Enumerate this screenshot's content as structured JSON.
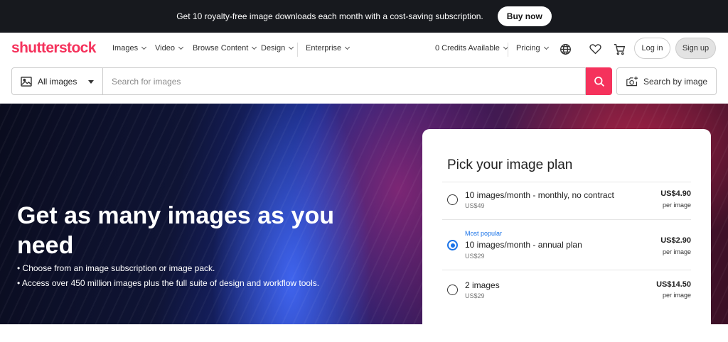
{
  "promo": {
    "text": "Get 10 royalty-free image downloads each month with a cost-saving subscription.",
    "button": "Buy now"
  },
  "header": {
    "logo": "shutterstock",
    "nav": [
      "Images",
      "Video",
      "Browse Content",
      "Design",
      "Enterprise"
    ],
    "credits": "0 Credits Available",
    "pricing": "Pricing",
    "icons": [
      "globe-icon",
      "heart-icon",
      "cart-icon"
    ],
    "login": "Log in",
    "signup": "Sign up"
  },
  "search": {
    "type": "All images",
    "placeholder": "Search for images",
    "by_image": "Search by image"
  },
  "hero": {
    "title": "Get as many images as you need",
    "bullets": [
      "• Choose from an image subscription or image pack.",
      "• Access over 450 million images plus the full suite of design and workflow tools."
    ]
  },
  "plans": {
    "title": "Pick your image plan",
    "items": [
      {
        "name": "10 images/month - monthly, no contract",
        "sub": "US$49",
        "tag": "",
        "price": "US$4.90",
        "per": "per image",
        "selected": false
      },
      {
        "name": "10 images/month - annual plan",
        "sub": "US$29",
        "tag": "Most popular",
        "price": "US$2.90",
        "per": "per image",
        "selected": true
      },
      {
        "name": "2 images",
        "sub": "US$29",
        "tag": "",
        "price": "US$14.50",
        "per": "per image",
        "selected": false
      }
    ]
  },
  "colors": {
    "brand": "#f5325c",
    "promo_bg": "#17191e",
    "accent": "#1a73e8"
  }
}
